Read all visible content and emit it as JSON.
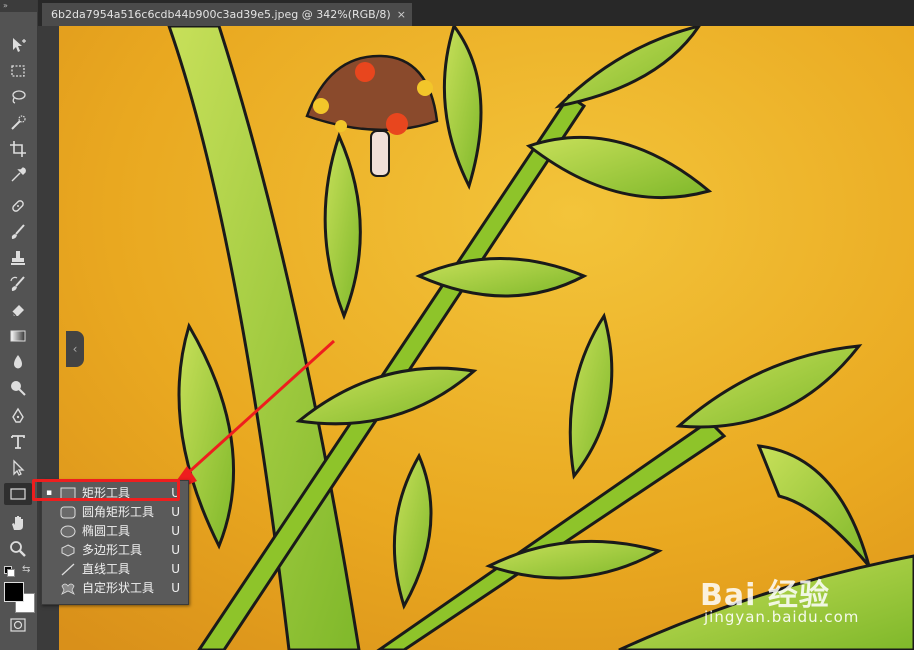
{
  "document": {
    "tab_title": "6b2da7954a516c6cdb44b900c3ad39e5.jpeg @ 342%(RGB/8)",
    "close_glyph": "×"
  },
  "toolbar": {
    "collapse_glyph": "»",
    "tools": [
      "move-icon",
      "marquee-icon",
      "lasso-icon",
      "quick-select-icon",
      "crop-icon",
      "eyedropper-icon",
      "healing-brush-icon",
      "brush-icon",
      "clone-stamp-icon",
      "history-brush-icon",
      "eraser-icon",
      "gradient-icon",
      "blur-icon",
      "dodge-icon",
      "pen-icon",
      "type-icon",
      "path-select-icon",
      "rectangle-icon",
      "hand-icon",
      "zoom-icon"
    ]
  },
  "panel_toggle": "‹",
  "flyout": {
    "items": [
      {
        "label": "矩形工具",
        "shortcut": "U",
        "selected": true,
        "icon": "rectangle-icon"
      },
      {
        "label": "圆角矩形工具",
        "shortcut": "U",
        "selected": false,
        "icon": "rounded-rectangle-icon"
      },
      {
        "label": "椭圆工具",
        "shortcut": "U",
        "selected": false,
        "icon": "ellipse-icon"
      },
      {
        "label": "多边形工具",
        "shortcut": "U",
        "selected": false,
        "icon": "polygon-icon"
      },
      {
        "label": "直线工具",
        "shortcut": "U",
        "selected": false,
        "icon": "line-icon"
      },
      {
        "label": "自定形状工具",
        "shortcut": "U",
        "selected": false,
        "icon": "custom-shape-icon"
      }
    ],
    "bullet": "▪"
  },
  "watermark": {
    "logo": "Bai 经验",
    "url": "jingyan.baidu.com"
  },
  "colors": {
    "accent_red": "#ee1e1e",
    "canvas_bg": "#e9a820",
    "leaf_green": "#9ccc2c"
  }
}
